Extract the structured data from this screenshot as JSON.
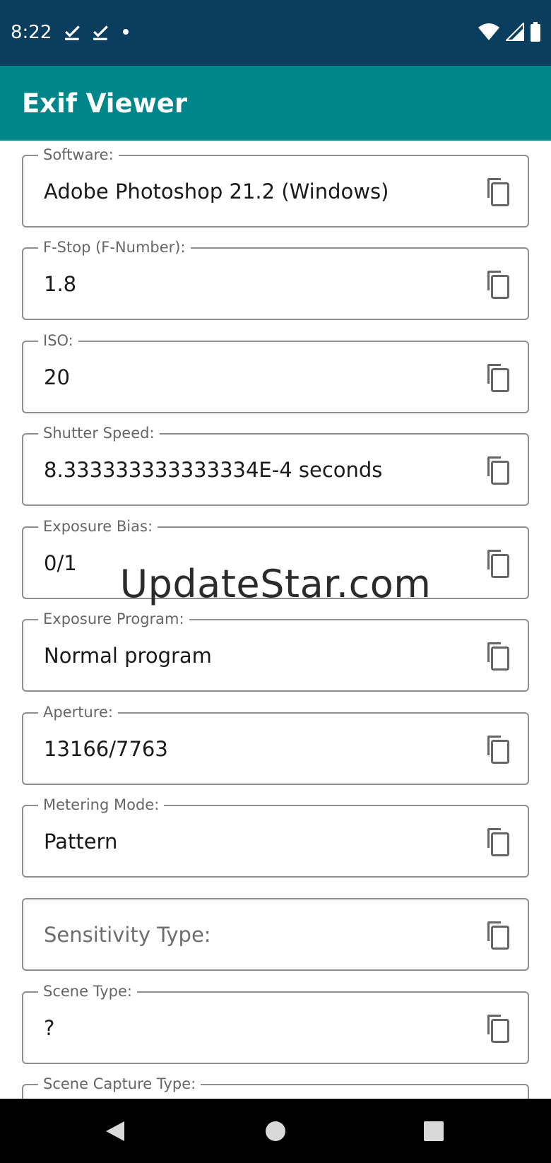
{
  "status_bar": {
    "time": "8:22",
    "left_icons": [
      "check-notification-icon",
      "check-notification-icon",
      "dot-icon"
    ],
    "right_icons": [
      "wifi-icon",
      "cellular-signal-icon",
      "battery-icon"
    ]
  },
  "app_bar": {
    "title": "Exif Viewer"
  },
  "fields": [
    {
      "label": "Software:",
      "value": "Adobe Photoshop 21.2 (Windows)"
    },
    {
      "label": "F-Stop (F-Number):",
      "value": "1.8"
    },
    {
      "label": "ISO:",
      "value": "20"
    },
    {
      "label": "Shutter Speed:",
      "value": "8.333333333333334E-4 seconds"
    },
    {
      "label": "Exposure Bias:",
      "value": "0/1"
    },
    {
      "label": "Exposure Program:",
      "value": "Normal program"
    },
    {
      "label": "Aperture:",
      "value": "13166/7763"
    },
    {
      "label": "Metering Mode:",
      "value": "Pattern"
    },
    {
      "label": "",
      "value": "",
      "placeholder": "Sensitivity Type:"
    },
    {
      "label": "Scene Type:",
      "value": "?"
    },
    {
      "label": "Scene Capture Type:",
      "value": ""
    }
  ],
  "watermark": "UpdateStar.com",
  "colors": {
    "status_bar": "#0b3d5e",
    "app_bar": "#00868a",
    "nav_bar": "#000000"
  }
}
